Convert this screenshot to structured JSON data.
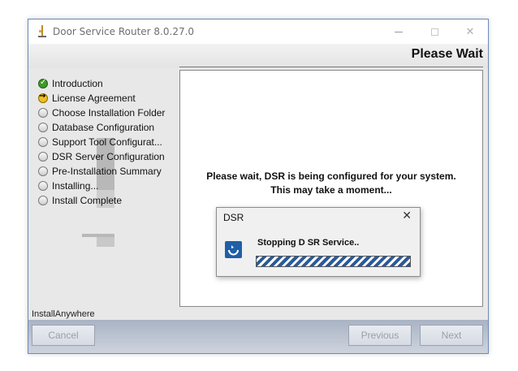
{
  "window": {
    "title": "Door Service Router 8.0.27.0",
    "controls": {
      "minimize": "—",
      "maximize": "",
      "close": "✕"
    }
  },
  "header": {
    "title": "Please Wait"
  },
  "steps": [
    {
      "label": "Introduction",
      "state": "done"
    },
    {
      "label": "License Agreement",
      "state": "current"
    },
    {
      "label": "Choose Installation Folder",
      "state": "pending"
    },
    {
      "label": "Database Configuration",
      "state": "pending"
    },
    {
      "label": "Support Tool Configurat...",
      "state": "pending"
    },
    {
      "label": "DSR Server Configuration",
      "state": "pending"
    },
    {
      "label": "Pre-Installation Summary",
      "state": "pending"
    },
    {
      "label": "Installing...",
      "state": "pending"
    },
    {
      "label": "Install Complete",
      "state": "pending"
    }
  ],
  "content": {
    "line1": "Please wait, DSR is being configured for your system.",
    "line2": "This may take a moment..."
  },
  "dialog": {
    "title": "DSR",
    "close": "✕",
    "status": "Stopping D SR Service..",
    "progress": 1.0,
    "icon": "dsr-app-icon"
  },
  "footer": {
    "brand": "InstallAnywhere",
    "cancel": "Cancel",
    "previous": "Previous",
    "next": "Next"
  },
  "colors": {
    "accent": "#1e5fa8",
    "done": "#3c9a28",
    "current": "#f0c020"
  }
}
